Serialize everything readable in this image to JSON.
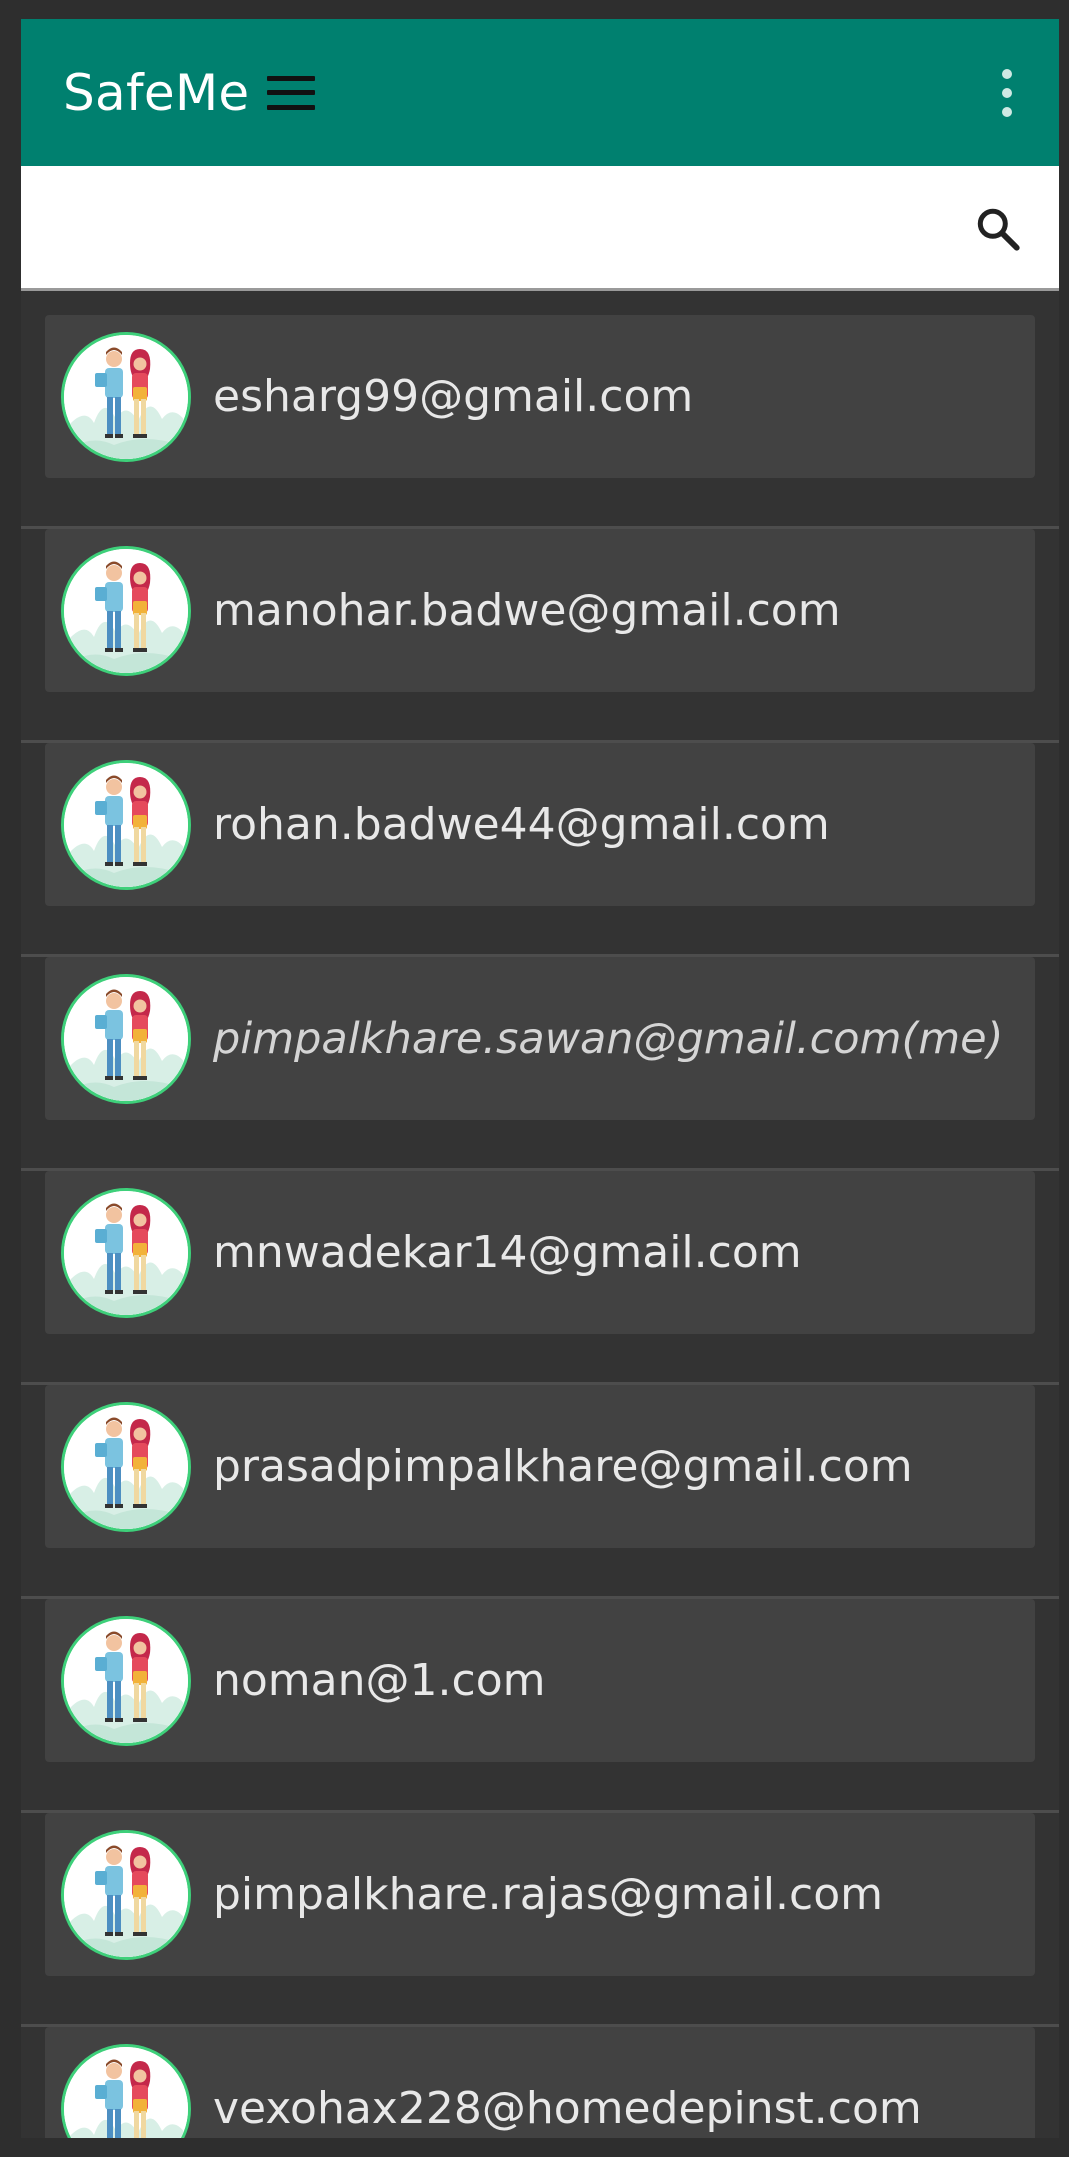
{
  "app": {
    "title": "SafeMe",
    "brand_color": "#00806f",
    "background_color": "#333333",
    "card_color": "#424242",
    "avatar_ring_color": "#3ed07a"
  },
  "toolbar": {
    "menu_icon": "hamburger-menu-icon",
    "overflow_icon": "more-vert-icon"
  },
  "search": {
    "value": "",
    "placeholder": "",
    "icon": "search-icon"
  },
  "contacts": [
    {
      "email": "esharg99@gmail.com",
      "is_me": false
    },
    {
      "email": "manohar.badwe@gmail.com",
      "is_me": false
    },
    {
      "email": "rohan.badwe44@gmail.com",
      "is_me": false
    },
    {
      "email": "pimpalkhare.sawan@gmail.com(me)",
      "is_me": true
    },
    {
      "email": "mnwadekar14@gmail.com",
      "is_me": false
    },
    {
      "email": "prasadpimpalkhare@gmail.com",
      "is_me": false
    },
    {
      "email": "noman@1.com",
      "is_me": false
    },
    {
      "email": "pimpalkhare.rajas@gmail.com",
      "is_me": false
    },
    {
      "email": "vexohax228@homedepinst.com",
      "is_me": false
    }
  ]
}
